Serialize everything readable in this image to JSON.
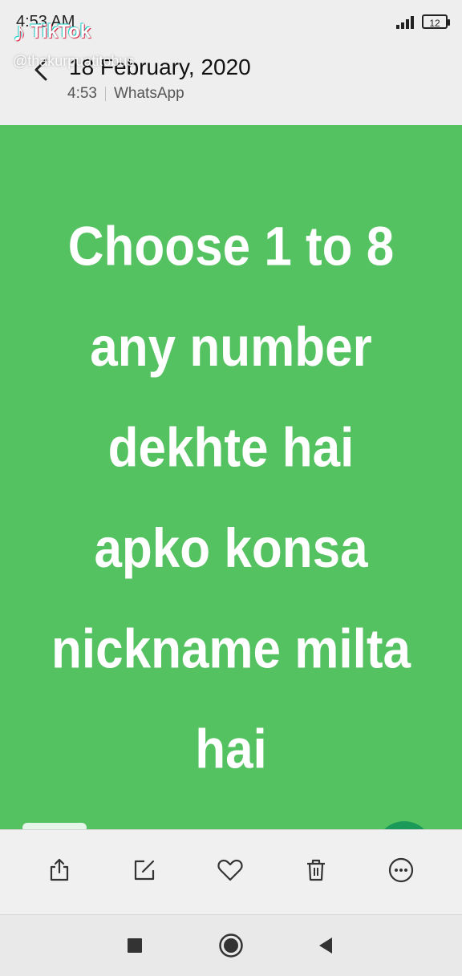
{
  "status_bar": {
    "time": "4:53 AM",
    "battery": "12"
  },
  "overlay": {
    "brand": "TikTok",
    "handle": "@thakurpuatitobus"
  },
  "header": {
    "title": "18 February, 2020",
    "time": "4:53",
    "source": "WhatsApp"
  },
  "content": {
    "background": "#55c261",
    "lines": [
      "Choose 1 to 8",
      "any number",
      "dekhte hai",
      "apko konsa",
      "nickname milta",
      "hai"
    ]
  },
  "toolbar": {
    "icons": [
      "share-icon",
      "edit-icon",
      "heart-icon",
      "trash-icon",
      "more-icon"
    ]
  },
  "navbar": {
    "icons": [
      "recent-apps-icon",
      "home-icon",
      "back-icon"
    ]
  }
}
